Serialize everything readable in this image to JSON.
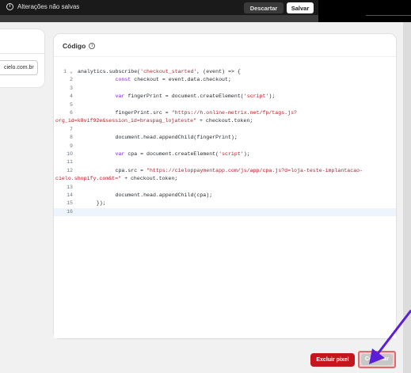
{
  "savebar": {
    "message": "Alterações não salvas",
    "discard_label": "Descartar",
    "save_label": "Salvar"
  },
  "left_card": {
    "field_value": "cielo.com.br"
  },
  "code_card": {
    "title": "Código",
    "lines": [
      {
        "n": "1",
        "fold": "⌄",
        "parts": [
          [
            "analytics.subscribe(",
            ""
          ],
          [
            "'checkout_started'",
            "s"
          ],
          [
            ", (event) => {",
            ""
          ]
        ]
      },
      {
        "n": "2",
        "parts": [
          [
            "            ",
            ""
          ],
          [
            "const",
            "k"
          ],
          [
            " checkout = event.data.checkout;",
            ""
          ]
        ]
      },
      {
        "n": "3",
        "parts": []
      },
      {
        "n": "4",
        "parts": [
          [
            "            ",
            ""
          ],
          [
            "var",
            "k"
          ],
          [
            " fingerPrint = document.createElement(",
            ""
          ],
          [
            "'script'",
            "s"
          ],
          [
            ");",
            ""
          ]
        ]
      },
      {
        "n": "5",
        "parts": []
      },
      {
        "n": "6",
        "parts": [
          [
            "            fingerPrint.src = ",
            ""
          ],
          [
            "\"https://h.online-metrix.net/fp/tags.js?",
            "s"
          ]
        ]
      },
      {
        "n": "",
        "parts": [
          [
            "org_id=k8vif92e&session_id=braspag_lojateste\"",
            "s"
          ],
          [
            " + checkout.token;",
            ""
          ]
        ],
        "cont": true
      },
      {
        "n": "7",
        "parts": []
      },
      {
        "n": "8",
        "parts": [
          [
            "            document.head.appendChild(fingerPrint);",
            ""
          ]
        ]
      },
      {
        "n": "9",
        "parts": []
      },
      {
        "n": "10",
        "parts": [
          [
            "            ",
            ""
          ],
          [
            "var",
            "k"
          ],
          [
            " cpa = document.createElement(",
            ""
          ],
          [
            "'script'",
            "s"
          ],
          [
            ");",
            ""
          ]
        ]
      },
      {
        "n": "11",
        "parts": []
      },
      {
        "n": "12",
        "parts": [
          [
            "            cpa.src = ",
            ""
          ],
          [
            "\"https://cieloppaymentapp.com/js/app/cpa.js?d=loja-teste-implantacao-",
            "s"
          ]
        ]
      },
      {
        "n": "",
        "parts": [
          [
            "cielo.shopify.com&t=\"",
            "s"
          ],
          [
            " + checkout.token;",
            ""
          ]
        ],
        "cont": true
      },
      {
        "n": "13",
        "parts": []
      },
      {
        "n": "14",
        "parts": [
          [
            "            document.head.appendChild(cpa);",
            ""
          ]
        ]
      },
      {
        "n": "15",
        "parts": [
          [
            "      });",
            ""
          ]
        ]
      },
      {
        "n": "16",
        "parts": [],
        "active": true
      }
    ]
  },
  "actions": {
    "delete_label": "Excluir pixel",
    "connect_label": "Conectar"
  },
  "colors": {
    "danger": "#c5161d",
    "disabled": "#c7c7c7",
    "highlight_border": "#e06a6a",
    "arrow": "#5a1fd6"
  }
}
